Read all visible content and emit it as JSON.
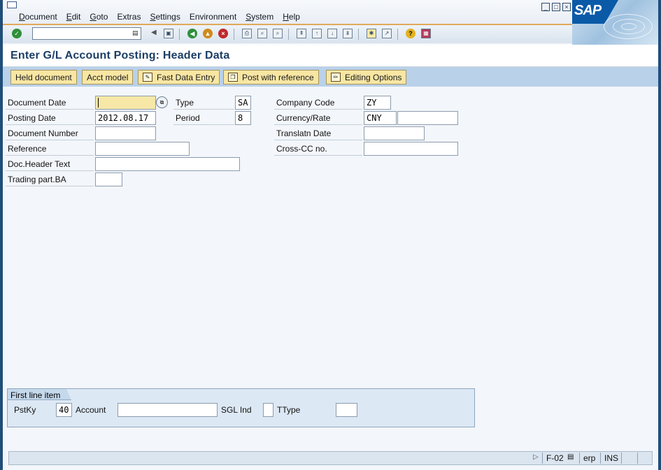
{
  "menu": {
    "items": [
      {
        "label": "Document",
        "u": "D",
        "rest": "ocument"
      },
      {
        "label": "Edit",
        "u": "E",
        "rest": "dit"
      },
      {
        "label": "Goto",
        "u": "G",
        "rest": "oto"
      },
      {
        "label": "Extras",
        "u": "",
        "rest": "Extras"
      },
      {
        "label": "Settings",
        "u": "S",
        "rest": "ettings"
      },
      {
        "label": "Environment",
        "u": "",
        "rest": "Environment"
      },
      {
        "label": "System",
        "u": "S",
        "rest": "ystem"
      },
      {
        "label": "Help",
        "u": "H",
        "rest": "elp"
      }
    ]
  },
  "logo_text": "SAP",
  "command_field": {
    "value": ""
  },
  "title": "Enter G/L Account Posting: Header Data",
  "app_toolbar": {
    "held_document": "Held document",
    "acct_model": "Acct model",
    "fast_data_entry": "Fast Data Entry",
    "post_with_reference": "Post with reference",
    "editing_options": "Editing Options"
  },
  "form": {
    "document_date": {
      "label": "Document Date",
      "value": ""
    },
    "type": {
      "label": "Type",
      "value": "SA"
    },
    "company_code": {
      "label": "Company Code",
      "value": "ZY"
    },
    "posting_date": {
      "label": "Posting Date",
      "value": "2012.08.17"
    },
    "period": {
      "label": "Period",
      "value": "8"
    },
    "currency_rate": {
      "label": "Currency/Rate",
      "value": "CNY",
      "rate": ""
    },
    "document_number": {
      "label": "Document Number",
      "value": ""
    },
    "translatn_date": {
      "label": "Translatn Date",
      "value": ""
    },
    "reference": {
      "label": "Reference",
      "value": ""
    },
    "cross_cc_no": {
      "label": "Cross-CC no.",
      "value": ""
    },
    "doc_header_text": {
      "label": "Doc.Header Text",
      "value": ""
    },
    "trading_part_ba": {
      "label": "Trading part.BA",
      "value": ""
    }
  },
  "first_line_item": {
    "title": "First line item",
    "pstky": {
      "label": "PstKy",
      "value": "40"
    },
    "account": {
      "label": "Account",
      "value": ""
    },
    "sgl_ind": {
      "label": "SGL Ind",
      "value": ""
    },
    "ttype": {
      "label": "TType",
      "value": ""
    }
  },
  "status_bar": {
    "transaction": "F-02",
    "system": "erp",
    "mode": "INS"
  },
  "colors": {
    "accent_orange": "#e0a95b",
    "title_blue": "#1c3e66",
    "button_yellow": "#f8e6a3",
    "focus_field": "#f7e8a8"
  }
}
